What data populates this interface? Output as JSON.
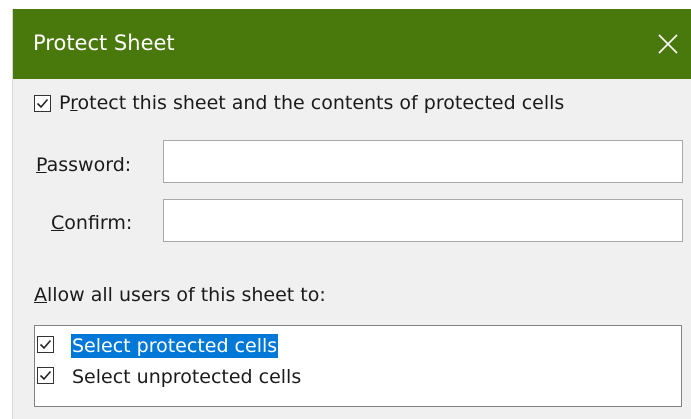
{
  "dialog": {
    "title": "Protect Sheet",
    "close_icon": "close-icon",
    "accent_color": "#49780d"
  },
  "protect_checkbox": {
    "checked": true,
    "label_before": "P",
    "label_mnemonic": "r",
    "label_after": "otect this sheet and the contents of protected cells"
  },
  "password": {
    "label_mnemonic": "P",
    "label_rest": "assword:",
    "value": ""
  },
  "confirm": {
    "label_mnemonic": "C",
    "label_rest": "onfirm:",
    "value": ""
  },
  "allow": {
    "label_mnemonic": "A",
    "label_rest": "llow all users of this sheet to:",
    "items": [
      {
        "label": "Select protected cells",
        "checked": true,
        "selected": true
      },
      {
        "label": "Select unprotected cells",
        "checked": true,
        "selected": false
      }
    ],
    "selection_color": "#0078d7"
  }
}
